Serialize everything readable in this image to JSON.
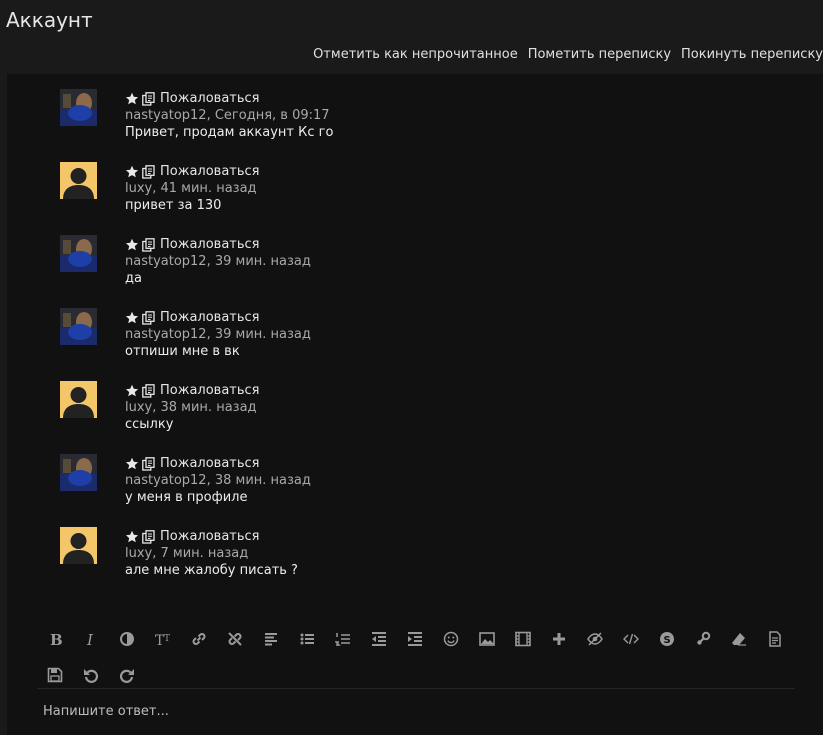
{
  "page": {
    "title": "Аккаунт"
  },
  "actions": {
    "mark_unread": "Отметить как непрочитанное",
    "flag": "Пометить переписку",
    "leave": "Покинуть переписку"
  },
  "messages": [
    {
      "author": "nastyatop12",
      "avatar": "photo",
      "time": "Сегодня, в 09:17",
      "meta": "nastyatop12, Сегодня, в 09:17",
      "text": "Привет, продам аккаунт Кс го",
      "report": "Пожаловаться"
    },
    {
      "author": "luxy",
      "avatar": "default",
      "time": "41 мин. назад",
      "meta": "luxy, 41 мин. назад",
      "text": "привет за 130",
      "report": "Пожаловаться"
    },
    {
      "author": "nastyatop12",
      "avatar": "photo",
      "time": "39 мин. назад",
      "meta": "nastyatop12, 39 мин. назад",
      "text": "да",
      "report": "Пожаловаться"
    },
    {
      "author": "nastyatop12",
      "avatar": "photo",
      "time": "39 мин. назад",
      "meta": "nastyatop12, 39 мин. назад",
      "text": "отпиши мне в вк",
      "report": "Пожаловаться"
    },
    {
      "author": "luxy",
      "avatar": "default",
      "time": "38 мин. назад",
      "meta": "luxy, 38 мин. назад",
      "text": "ссылку",
      "report": "Пожаловаться"
    },
    {
      "author": "nastyatop12",
      "avatar": "photo",
      "time": "38 мин. назад",
      "meta": "nastyatop12, 38 мин. назад",
      "text": "у меня в профиле",
      "report": "Пожаловаться"
    },
    {
      "author": "luxy",
      "avatar": "default",
      "time": "7 мин. назад",
      "meta": "luxy, 7 мин. назад",
      "text": "але мне жалобу писать ?",
      "report": "Пожаловаться"
    }
  ],
  "toolbar": {
    "row1": [
      "bold-icon",
      "italic-icon",
      "color-icon",
      "font-size-icon",
      "link-icon",
      "unlink-icon",
      "align-icon",
      "bullet-list-icon",
      "numbered-list-icon",
      "outdent-icon",
      "indent-icon",
      "smiley-icon",
      "image-icon",
      "media-icon",
      "insert-icon",
      "hide-icon",
      "code-icon",
      "skype-icon",
      "steam-icon",
      "remove-format-icon",
      "drafts-icon"
    ],
    "row2": [
      "save-icon",
      "undo-icon",
      "redo-icon"
    ]
  },
  "reply": {
    "placeholder": "Напишите ответ..."
  },
  "colors": {
    "background": "#1a1a1a",
    "panel": "#111111",
    "meta": "#a9a9a9",
    "text": "#ededed",
    "icon": "#9a9a9a"
  }
}
